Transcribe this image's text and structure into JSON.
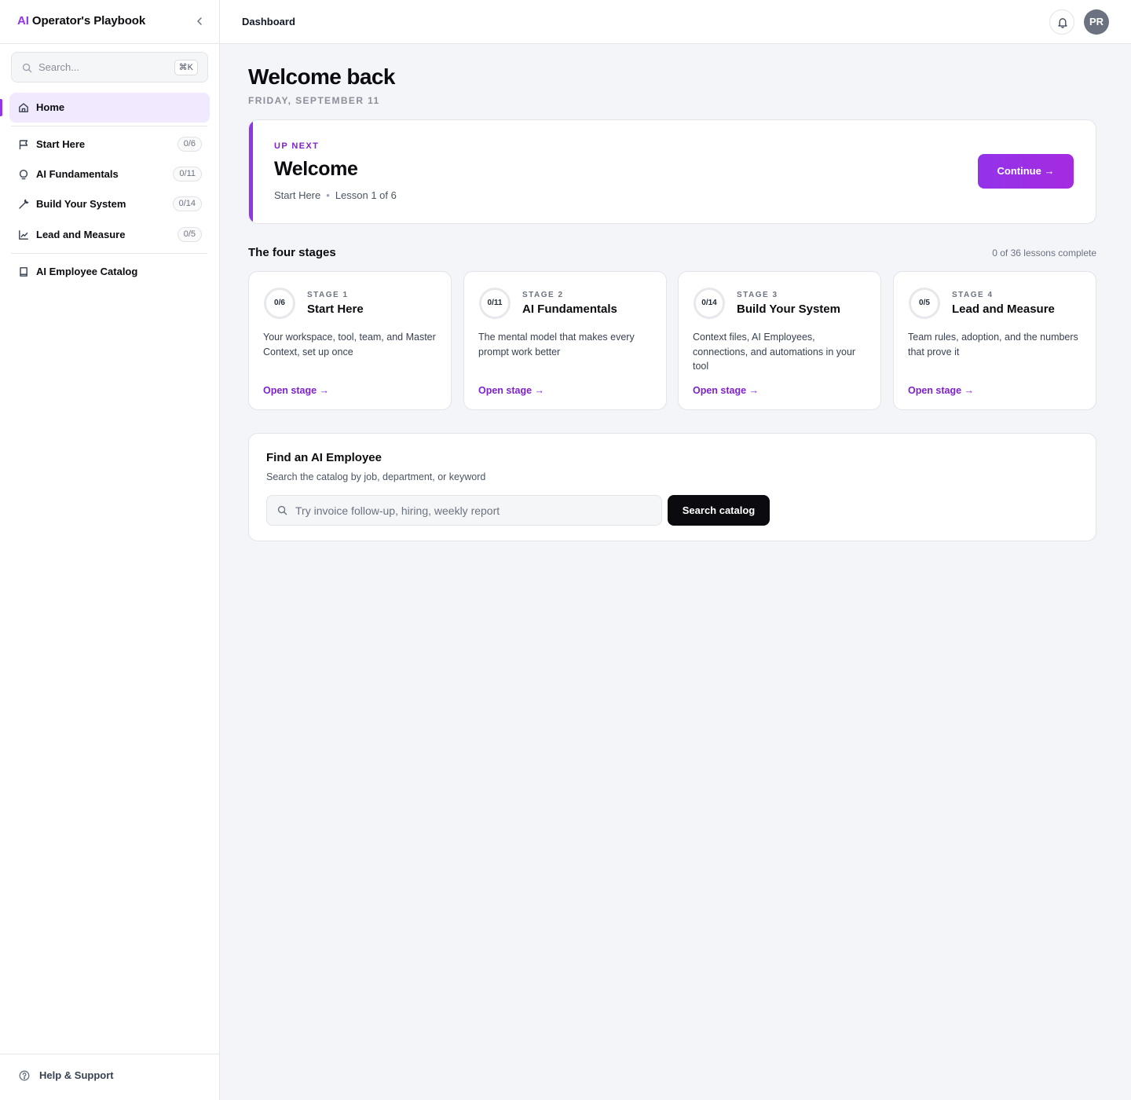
{
  "app": {
    "brand_prefix": "AI",
    "brand_rest": " Operator's Playbook"
  },
  "sidebar": {
    "search_placeholder": "Search...",
    "search_shortcut": "⌘K",
    "home_label": "Home",
    "stages": [
      {
        "label": "Start Here",
        "count": "0/6",
        "icon": "flag-icon"
      },
      {
        "label": "AI Fundamentals",
        "count": "0/11",
        "icon": "lightbulb-icon"
      },
      {
        "label": "Build Your System",
        "count": "0/14",
        "icon": "wrench-icon"
      },
      {
        "label": "Lead and Measure",
        "count": "0/5",
        "icon": "chart-icon"
      }
    ],
    "catalog_label": "AI Employee Catalog",
    "help_label": "Help & Support"
  },
  "header": {
    "breadcrumb": "Dashboard",
    "avatar_initials": "PR"
  },
  "main": {
    "title": "Welcome back",
    "date": "FRIDAY, SEPTEMBER 11",
    "up_next": {
      "eyebrow": "UP NEXT",
      "title": "Welcome",
      "stage": "Start Here",
      "lesson": "Lesson 1 of 6",
      "continue_label": "Continue  →"
    },
    "stages_title": "The four stages",
    "stages_meta": "0 of 36 lessons complete",
    "stage_cards": [
      {
        "progress": "0/6",
        "num": "STAGE 1",
        "name": "Start Here",
        "desc": "Your workspace, tool, team, and Master Context, set up once",
        "link": "Open stage →"
      },
      {
        "progress": "0/11",
        "num": "STAGE 2",
        "name": "AI Fundamentals",
        "desc": "The mental model that makes every prompt work better",
        "link": "Open stage →"
      },
      {
        "progress": "0/14",
        "num": "STAGE 3",
        "name": "Build Your System",
        "desc": "Context files, AI Employees, connections, and automations in your tool",
        "link": "Open stage →"
      },
      {
        "progress": "0/5",
        "num": "STAGE 4",
        "name": "Lead and Measure",
        "desc": "Team rules, adoption, and the numbers that prove it",
        "link": "Open stage →"
      }
    ],
    "finder": {
      "title": "Find an AI Employee",
      "subtitle": "Search the catalog by job, department, or keyword",
      "placeholder": "Try invoice follow-up, hiring, weekly report",
      "button_label": "Search catalog"
    }
  },
  "colors": {
    "accent": "#9333ea",
    "accent_text": "#7e22ce",
    "active_bg": "#f1e9fd",
    "dark_button": "#0b0b0f"
  }
}
